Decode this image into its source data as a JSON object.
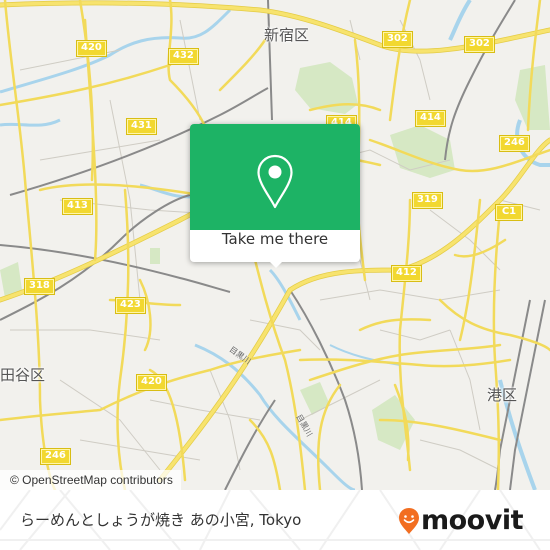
{
  "map": {
    "attribution": "© OpenStreetMap contributors",
    "colors": {
      "background": "#f2f1ed",
      "major_road": "#f5e06a",
      "major_road_casing": "#e0c83c",
      "minor_road": "#c8c5bd",
      "railway": "#8a8a8a",
      "river": "#a8d4ec",
      "park": "#d6e8c4"
    },
    "route_shields": [
      {
        "label": "420"
      },
      {
        "label": "432"
      },
      {
        "label": "431"
      },
      {
        "label": "413"
      },
      {
        "label": "318"
      },
      {
        "label": "423"
      },
      {
        "label": "420"
      },
      {
        "label": "246"
      },
      {
        "label": "302"
      },
      {
        "label": "302"
      },
      {
        "label": "414"
      },
      {
        "label": "414"
      },
      {
        "label": "246"
      },
      {
        "label": "319"
      },
      {
        "label": "C1"
      },
      {
        "label": "412"
      }
    ],
    "district_labels": {
      "shinjuku": "新宿区",
      "setagaya": "田谷区",
      "minato": "港区"
    },
    "river_label": "目黒川"
  },
  "popup": {
    "icon": "map-pin-icon",
    "button_label": "Take me there",
    "color": "#1db365"
  },
  "footer": {
    "place_name": "らーめんとしょうが焼き あの小宮, Tokyo",
    "logo_text": "moovit",
    "logo_icon": "moovit-smiley-pin-icon",
    "logo_color": "#f26e21"
  }
}
